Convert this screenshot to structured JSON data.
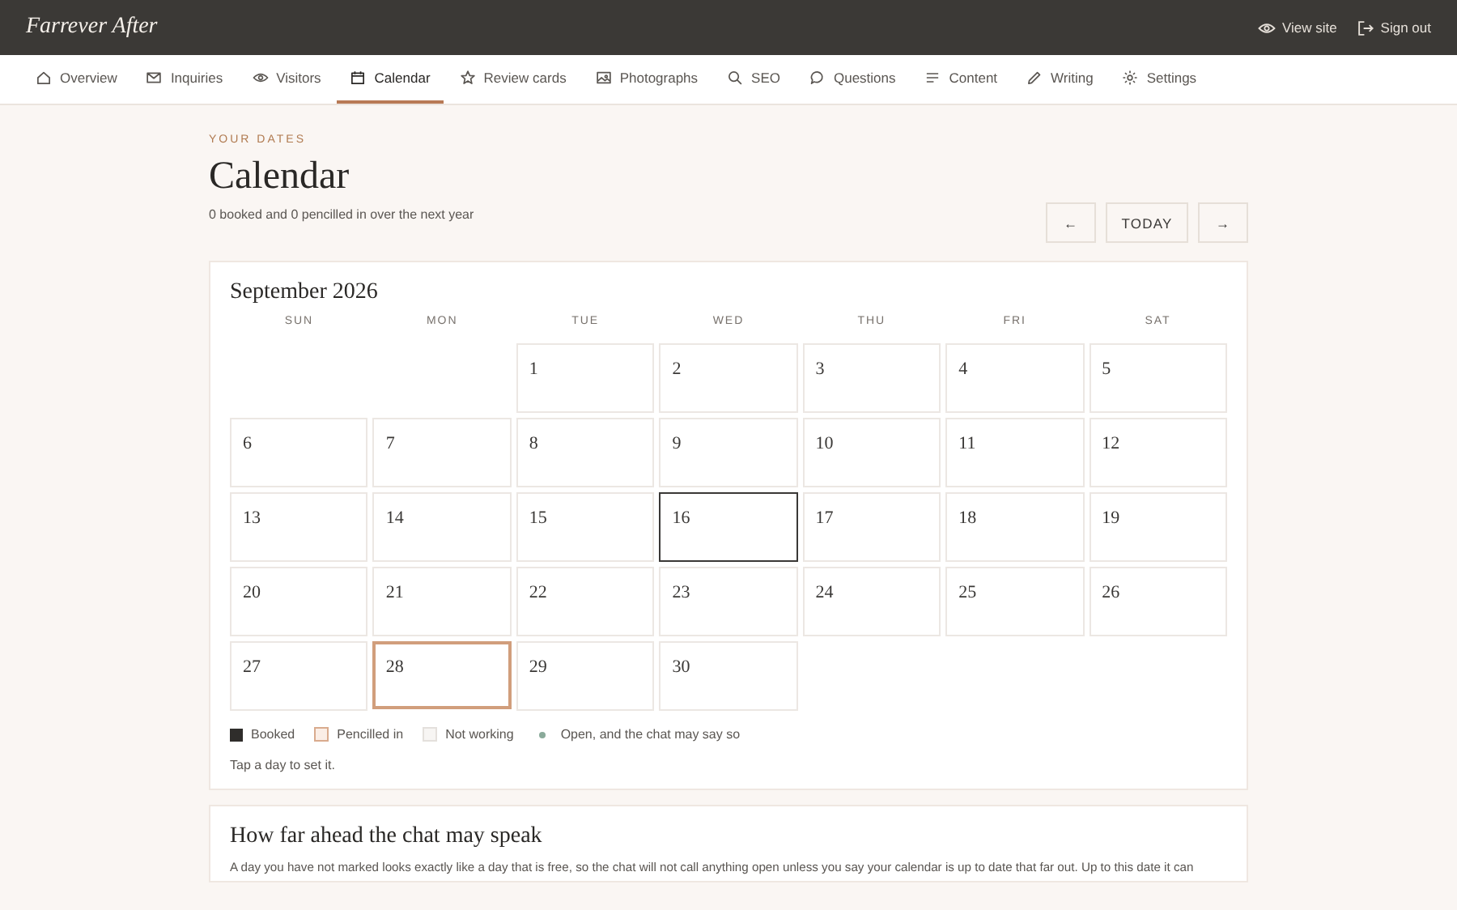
{
  "brand": "Farrever After",
  "header_links": [
    {
      "label": "View site"
    },
    {
      "label": "Sign out"
    }
  ],
  "tabs": [
    {
      "label": "Overview",
      "selected": false
    },
    {
      "label": "Inquiries",
      "selected": false
    },
    {
      "label": "Visitors",
      "selected": false
    },
    {
      "label": "Calendar",
      "selected": true
    },
    {
      "label": "Review cards",
      "selected": false
    },
    {
      "label": "Photographs",
      "selected": false
    },
    {
      "label": "SEO",
      "selected": false
    },
    {
      "label": "Questions",
      "selected": false
    },
    {
      "label": "Content",
      "selected": false
    },
    {
      "label": "Writing",
      "selected": false
    },
    {
      "label": "Settings",
      "selected": false
    }
  ],
  "eyebrow": "YOUR DATES",
  "title": "Calendar",
  "summary": "0 booked and 0 pencilled in over the next year",
  "nav_buttons": {
    "previous": "←",
    "today": "TODAY",
    "next": "→"
  },
  "calendar": {
    "month": "September 2026",
    "weekdays": [
      "SUN",
      "MON",
      "TUE",
      "WED",
      "THU",
      "FRI",
      "SAT"
    ],
    "days": [
      {
        "kind": "empty"
      },
      {
        "kind": "empty"
      },
      {
        "kind": "day",
        "label": "1",
        "today": false,
        "selected": false
      },
      {
        "kind": "day",
        "label": "2",
        "today": false,
        "selected": false
      },
      {
        "kind": "day",
        "label": "3",
        "today": false,
        "selected": false
      },
      {
        "kind": "day",
        "label": "4",
        "today": false,
        "selected": false
      },
      {
        "kind": "day",
        "label": "5",
        "today": false,
        "selected": false
      },
      {
        "kind": "day",
        "label": "6",
        "today": false,
        "selected": false
      },
      {
        "kind": "day",
        "label": "7",
        "today": false,
        "selected": false
      },
      {
        "kind": "day",
        "label": "8",
        "today": false,
        "selected": false
      },
      {
        "kind": "day",
        "label": "9",
        "today": false,
        "selected": false
      },
      {
        "kind": "day",
        "label": "10",
        "today": false,
        "selected": false
      },
      {
        "kind": "day",
        "label": "11",
        "today": false,
        "selected": false
      },
      {
        "kind": "day",
        "label": "12",
        "today": false,
        "selected": false
      },
      {
        "kind": "day",
        "label": "13",
        "today": false,
        "selected": false
      },
      {
        "kind": "day",
        "label": "14",
        "today": false,
        "selected": false
      },
      {
        "kind": "day",
        "label": "15",
        "today": false,
        "selected": false
      },
      {
        "kind": "day",
        "label": "16",
        "today": true,
        "selected": false
      },
      {
        "kind": "day",
        "label": "17",
        "today": false,
        "selected": false
      },
      {
        "kind": "day",
        "label": "18",
        "today": false,
        "selected": false
      },
      {
        "kind": "day",
        "label": "19",
        "today": false,
        "selected": false
      },
      {
        "kind": "day",
        "label": "20",
        "today": false,
        "selected": false
      },
      {
        "kind": "day",
        "label": "21",
        "today": false,
        "selected": false
      },
      {
        "kind": "day",
        "label": "22",
        "today": false,
        "selected": false
      },
      {
        "kind": "day",
        "label": "23",
        "today": false,
        "selected": false
      },
      {
        "kind": "day",
        "label": "24",
        "today": false,
        "selected": false
      },
      {
        "kind": "day",
        "label": "25",
        "today": false,
        "selected": false
      },
      {
        "kind": "day",
        "label": "26",
        "today": false,
        "selected": false
      },
      {
        "kind": "day",
        "label": "27",
        "today": false,
        "selected": false
      },
      {
        "kind": "day",
        "label": "28",
        "today": false,
        "selected": true
      },
      {
        "kind": "day",
        "label": "29",
        "today": false,
        "selected": false
      },
      {
        "kind": "day",
        "label": "30",
        "today": false,
        "selected": false
      }
    ],
    "legend": [
      {
        "kind": "booked",
        "label": "Booked"
      },
      {
        "kind": "pencilled",
        "label": "Pencilled in"
      },
      {
        "kind": "off",
        "label": "Not working"
      },
      {
        "kind": "open",
        "label": "Open, and the chat may say so"
      }
    ],
    "hint": "Tap a day to set it."
  },
  "horizon": {
    "title": "How far ahead the chat may speak",
    "text": "A day you have not marked looks exactly like a day that is free, so the chat will not call anything open unless you say your calendar is up to date that far out. Up to this date it can"
  }
}
